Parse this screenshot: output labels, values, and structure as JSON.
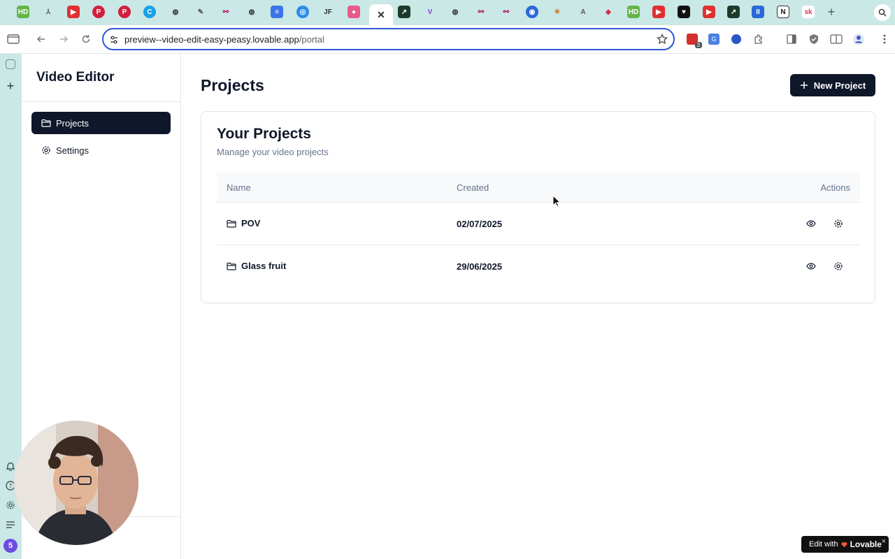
{
  "browser": {
    "url_host": "preview--video-edit-easy-peasy.lovable.app",
    "url_path": "/portal",
    "extension_badge": "3"
  },
  "sidebar": {
    "title": "Video Editor",
    "items": [
      {
        "label": "Projects",
        "icon": "folder-icon",
        "active": true
      },
      {
        "label": "Settings",
        "icon": "gear-icon",
        "active": false
      }
    ]
  },
  "rail": {
    "badge": "5"
  },
  "main": {
    "title": "Projects",
    "new_button_label": "New Project",
    "card": {
      "title": "Your Projects",
      "subtitle": "Manage your video projects",
      "columns": [
        "Name",
        "Created",
        "Actions"
      ],
      "rows": [
        {
          "name": "POV",
          "created": "02/07/2025"
        },
        {
          "name": "Glass fruit",
          "created": "29/06/2025"
        }
      ]
    }
  },
  "lovable_badge": {
    "prefix": "Edit with",
    "brand": "Lovable",
    "close": "×"
  },
  "colors": {
    "primary": "#0f172a",
    "muted_text": "#64748b",
    "tab_bg": "#c9e8e6",
    "omnibox_border": "#2b57d6"
  }
}
